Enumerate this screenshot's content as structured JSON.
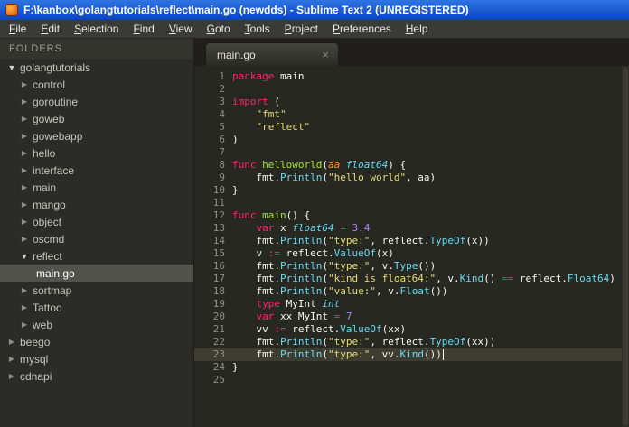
{
  "window": {
    "title": "F:\\kanbox\\golangtutorials\\reflect\\main.go (newdds) - Sublime Text 2 (UNREGISTERED)"
  },
  "menubar": {
    "items": [
      "File",
      "Edit",
      "Selection",
      "Find",
      "View",
      "Goto",
      "Tools",
      "Project",
      "Preferences",
      "Help"
    ]
  },
  "sidebar": {
    "header": "FOLDERS",
    "items": [
      {
        "label": "golangtutorials",
        "level": 0,
        "kind": "folder",
        "expanded": true
      },
      {
        "label": "control",
        "level": 1,
        "kind": "folder",
        "expanded": false
      },
      {
        "label": "goroutine",
        "level": 1,
        "kind": "folder",
        "expanded": false
      },
      {
        "label": "goweb",
        "level": 1,
        "kind": "folder",
        "expanded": false
      },
      {
        "label": "gowebapp",
        "level": 1,
        "kind": "folder",
        "expanded": false
      },
      {
        "label": "hello",
        "level": 1,
        "kind": "folder",
        "expanded": false
      },
      {
        "label": "interface",
        "level": 1,
        "kind": "folder",
        "expanded": false
      },
      {
        "label": "main",
        "level": 1,
        "kind": "folder",
        "expanded": false
      },
      {
        "label": "mango",
        "level": 1,
        "kind": "folder",
        "expanded": false
      },
      {
        "label": "object",
        "level": 1,
        "kind": "folder",
        "expanded": false
      },
      {
        "label": "oscmd",
        "level": 1,
        "kind": "folder",
        "expanded": false
      },
      {
        "label": "reflect",
        "level": 1,
        "kind": "folder",
        "expanded": true
      },
      {
        "label": "main.go",
        "level": 2,
        "kind": "file",
        "selected": true
      },
      {
        "label": "sortmap",
        "level": 1,
        "kind": "folder",
        "expanded": false
      },
      {
        "label": "Tattoo",
        "level": 1,
        "kind": "folder",
        "expanded": false
      },
      {
        "label": "web",
        "level": 1,
        "kind": "folder",
        "expanded": false
      },
      {
        "label": "beego",
        "level": 0,
        "kind": "folder",
        "expanded": false
      },
      {
        "label": "mysql",
        "level": 0,
        "kind": "folder",
        "expanded": false
      },
      {
        "label": "cdnapi",
        "level": 0,
        "kind": "folder",
        "expanded": false
      }
    ]
  },
  "tabbar": {
    "close_glyph": "×",
    "tabs": [
      {
        "label": "main.go",
        "active": true
      }
    ]
  },
  "editor": {
    "language": "Go",
    "token_colors": {
      "k": "#f92672",
      "s": "#e6db74",
      "fn": "#a6e22e",
      "c": "#66d9ef",
      "t": "#66d9ef",
      "num": "#ae81ff",
      "o": "#f92672",
      "p": "#f8f8f2",
      "a": "#fd971f"
    },
    "ui_colors": {
      "editor_bg": "#272822",
      "current_line_bg": "#3e3d32",
      "gutter_text": "#8f908a",
      "sidebar_selection_bg": "#52524c",
      "titlebar_blue": "#0b44c0"
    },
    "lines": [
      {
        "n": "1",
        "seg": [
          [
            "k",
            "package"
          ],
          [
            "p",
            " main"
          ]
        ]
      },
      {
        "n": "2",
        "seg": []
      },
      {
        "n": "3",
        "seg": [
          [
            "k",
            "import"
          ],
          [
            "p",
            " ("
          ]
        ]
      },
      {
        "n": "4",
        "seg": [
          [
            "p",
            "    "
          ],
          [
            "s",
            "\"fmt\""
          ]
        ]
      },
      {
        "n": "5",
        "seg": [
          [
            "p",
            "    "
          ],
          [
            "s",
            "\"reflect\""
          ]
        ]
      },
      {
        "n": "6",
        "seg": [
          [
            "p",
            ")"
          ]
        ]
      },
      {
        "n": "7",
        "seg": []
      },
      {
        "n": "8",
        "seg": [
          [
            "k",
            "func"
          ],
          [
            "p",
            " "
          ],
          [
            "fn",
            "helloworld"
          ],
          [
            "p",
            "("
          ],
          [
            "a",
            "aa"
          ],
          [
            "p",
            " "
          ],
          [
            "t",
            "float64"
          ],
          [
            "p",
            ") {"
          ]
        ]
      },
      {
        "n": "9",
        "seg": [
          [
            "p",
            "    fmt."
          ],
          [
            "c",
            "Println"
          ],
          [
            "p",
            "("
          ],
          [
            "s",
            "\"hello world\""
          ],
          [
            "p",
            ", aa)"
          ]
        ]
      },
      {
        "n": "10",
        "seg": [
          [
            "p",
            "}"
          ]
        ]
      },
      {
        "n": "11",
        "seg": []
      },
      {
        "n": "12",
        "seg": [
          [
            "k",
            "func"
          ],
          [
            "p",
            " "
          ],
          [
            "fn",
            "main"
          ],
          [
            "p",
            "() {"
          ]
        ]
      },
      {
        "n": "13",
        "seg": [
          [
            "p",
            "    "
          ],
          [
            "k",
            "var"
          ],
          [
            "p",
            " x "
          ],
          [
            "t",
            "float64"
          ],
          [
            "p",
            " "
          ],
          [
            "o",
            "="
          ],
          [
            "p",
            " "
          ],
          [
            "num",
            "3.4"
          ]
        ]
      },
      {
        "n": "14",
        "seg": [
          [
            "p",
            "    fmt."
          ],
          [
            "c",
            "Println"
          ],
          [
            "p",
            "("
          ],
          [
            "s",
            "\"type:\""
          ],
          [
            "p",
            ", reflect."
          ],
          [
            "c",
            "TypeOf"
          ],
          [
            "p",
            "(x))"
          ]
        ]
      },
      {
        "n": "15",
        "seg": [
          [
            "p",
            "    v "
          ],
          [
            "o",
            ":="
          ],
          [
            "p",
            " reflect."
          ],
          [
            "c",
            "ValueOf"
          ],
          [
            "p",
            "(x)"
          ]
        ]
      },
      {
        "n": "16",
        "seg": [
          [
            "p",
            "    fmt."
          ],
          [
            "c",
            "Println"
          ],
          [
            "p",
            "("
          ],
          [
            "s",
            "\"type:\""
          ],
          [
            "p",
            ", v."
          ],
          [
            "c",
            "Type"
          ],
          [
            "p",
            "())"
          ]
        ]
      },
      {
        "n": "17",
        "seg": [
          [
            "p",
            "    fmt."
          ],
          [
            "c",
            "Println"
          ],
          [
            "p",
            "("
          ],
          [
            "s",
            "\"kind is float64:\""
          ],
          [
            "p",
            ", v."
          ],
          [
            "c",
            "Kind"
          ],
          [
            "p",
            "() "
          ],
          [
            "o",
            "=="
          ],
          [
            "p",
            " reflect."
          ],
          [
            "c",
            "Float64"
          ],
          [
            "p",
            ")"
          ]
        ]
      },
      {
        "n": "18",
        "seg": [
          [
            "p",
            "    fmt."
          ],
          [
            "c",
            "Println"
          ],
          [
            "p",
            "("
          ],
          [
            "s",
            "\"value:\""
          ],
          [
            "p",
            ", v."
          ],
          [
            "c",
            "Float"
          ],
          [
            "p",
            "())"
          ]
        ]
      },
      {
        "n": "19",
        "seg": [
          [
            "p",
            "    "
          ],
          [
            "k",
            "type"
          ],
          [
            "p",
            " MyInt "
          ],
          [
            "t",
            "int"
          ]
        ]
      },
      {
        "n": "20",
        "seg": [
          [
            "p",
            "    "
          ],
          [
            "k",
            "var"
          ],
          [
            "p",
            " xx MyInt "
          ],
          [
            "o",
            "="
          ],
          [
            "p",
            " "
          ],
          [
            "num",
            "7"
          ]
        ]
      },
      {
        "n": "21",
        "seg": [
          [
            "p",
            "    vv "
          ],
          [
            "o",
            ":="
          ],
          [
            "p",
            " reflect."
          ],
          [
            "c",
            "ValueOf"
          ],
          [
            "p",
            "(xx)"
          ]
        ]
      },
      {
        "n": "22",
        "seg": [
          [
            "p",
            "    fmt."
          ],
          [
            "c",
            "Println"
          ],
          [
            "p",
            "("
          ],
          [
            "s",
            "\"type:\""
          ],
          [
            "p",
            ", reflect."
          ],
          [
            "c",
            "TypeOf"
          ],
          [
            "p",
            "(xx))"
          ]
        ]
      },
      {
        "n": "23",
        "seg": [
          [
            "p",
            "    fmt."
          ],
          [
            "c",
            "Println"
          ],
          [
            "p",
            "("
          ],
          [
            "s",
            "\"type:\""
          ],
          [
            "p",
            ", vv."
          ],
          [
            "c",
            "Kind"
          ],
          [
            "p",
            "())"
          ]
        ],
        "current": true,
        "cursor": true
      },
      {
        "n": "24",
        "seg": [
          [
            "p",
            "}"
          ]
        ]
      },
      {
        "n": "25",
        "seg": []
      }
    ]
  }
}
